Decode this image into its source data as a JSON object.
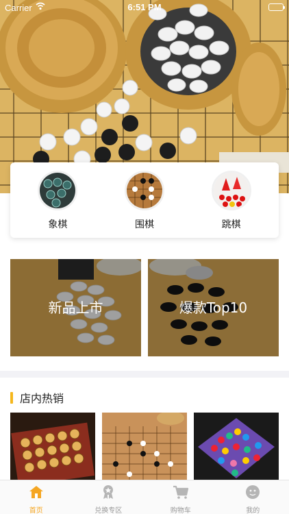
{
  "status_bar": {
    "carrier": "Carrier",
    "time": "6:51 PM",
    "battery_level": 1.0
  },
  "categories": [
    {
      "label": "象棋",
      "icon": "chinese-chess-icon"
    },
    {
      "label": "围棋",
      "icon": "go-board-icon"
    },
    {
      "label": "跳棋",
      "icon": "checkers-icon"
    }
  ],
  "banners": [
    {
      "title": "新品上市"
    },
    {
      "title": "爆款Top10"
    }
  ],
  "section": {
    "title": "店内热销"
  },
  "tabbar": {
    "tabs": [
      {
        "label": "首页",
        "icon": "home-icon",
        "active": true
      },
      {
        "label": "兑换专区",
        "icon": "exchange-icon",
        "active": false
      },
      {
        "label": "购物车",
        "icon": "cart-icon",
        "active": false
      },
      {
        "label": "我的",
        "icon": "profile-icon",
        "active": false
      }
    ]
  },
  "colors": {
    "accent": "#f5a623",
    "section_bar": "#f5b71c",
    "tab_inactive": "#9a9a9a"
  }
}
